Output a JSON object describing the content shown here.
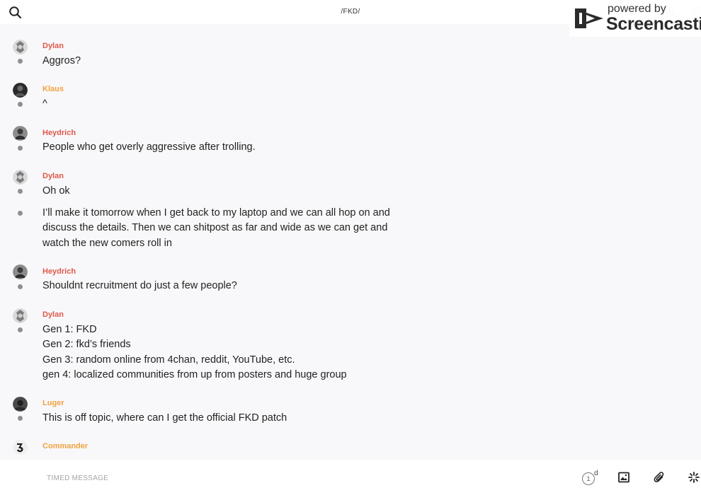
{
  "header": {
    "channel_title": "/FKD/",
    "search_icon": "search-icon",
    "call_icon": "phone-icon",
    "info_icon": "info-icon"
  },
  "watermark": {
    "line1": "powered by",
    "line2": "Screencastify"
  },
  "colors": {
    "sender_red": "#e0584b",
    "sender_orange": "#f1a33f",
    "link_blue": "#4a8bd8",
    "background": "#f8f8fa"
  },
  "messages": [
    {
      "sender": "Dylan",
      "text": "Aggros?"
    },
    {
      "sender": "Klaus",
      "text": "^"
    },
    {
      "sender": "Heydrich",
      "text": "People who get overly aggressive after trolling."
    },
    {
      "sender": "Dylan",
      "text": "Oh ok"
    },
    {
      "sender": "",
      "text": "I’ll make it tomorrow when I get back to my laptop and we can all hop on and discuss the details. Then we can shitpost as far and wide as we can get and watch the new comers roll in"
    },
    {
      "sender": "Heydrich",
      "text": "Shouldnt recruitment do just a few people?"
    },
    {
      "sender": "Dylan",
      "text": "Gen 1: FKD\nGen 2: fkd’s friends\nGen 3: random online from 4chan, reddit, YouTube, etc.\ngen 4: localized communities from up from posters and huge group"
    },
    {
      "sender": "Luger",
      "text": "This is off topic, where can I get the official FKD patch"
    },
    {
      "sender": "Commander",
      "text": ""
    }
  ],
  "composer": {
    "placeholder": "TIMED MESSAGE",
    "timer_value": "1",
    "timer_unit": "d",
    "image_icon": "image-icon",
    "attach_icon": "paperclip-icon",
    "spark_icon": "sparkle-icon"
  }
}
